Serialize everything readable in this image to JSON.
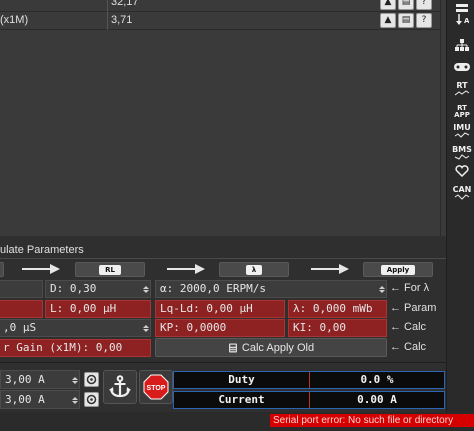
{
  "parameter_rows": [
    {
      "name": "",
      "value": "32,17"
    },
    {
      "name": "(x1M)",
      "value": "3,71"
    }
  ],
  "calc_group": {
    "title": "ulate Parameters",
    "step_buttons": [
      "RL",
      "λ",
      "Apply"
    ]
  },
  "fields": {
    "d": "D: 0,30",
    "alpha": "α: 2000,0 ERPM/s",
    "l": "L: 0,00 µH",
    "lqld": "Lq-Ld: 0,00 µH",
    "lambda": "λ: 0,000 mWb",
    "us": ",0 µS",
    "kp": "KP: 0,0000",
    "ki": "KI: 0,00",
    "gain": "r Gain (x1M): 0,00"
  },
  "side_labels": {
    "for_lambda": "← For λ",
    "param": "← Param",
    "calc1": "← Calc",
    "calc2": "← Calc"
  },
  "calc_apply_old": "Calc Apply Old",
  "bottom": {
    "current1": "3,00 A",
    "current2": "3,00 A",
    "stop_label": "STOP",
    "duty_label": "Duty",
    "duty_value": "0.0 %",
    "current_label": "Current",
    "current_value": "0.00 A"
  },
  "status": {
    "error": "Serial port error: No such file or directory"
  },
  "rail": {
    "rt": "RT",
    "rt_app": "RT\nAPP",
    "imu": "IMU",
    "bms": "BMS",
    "can": "CAN"
  },
  "colors": {
    "red_field": "#8e2222",
    "error_bg": "#d60000",
    "display_border": "#2b65b5"
  }
}
